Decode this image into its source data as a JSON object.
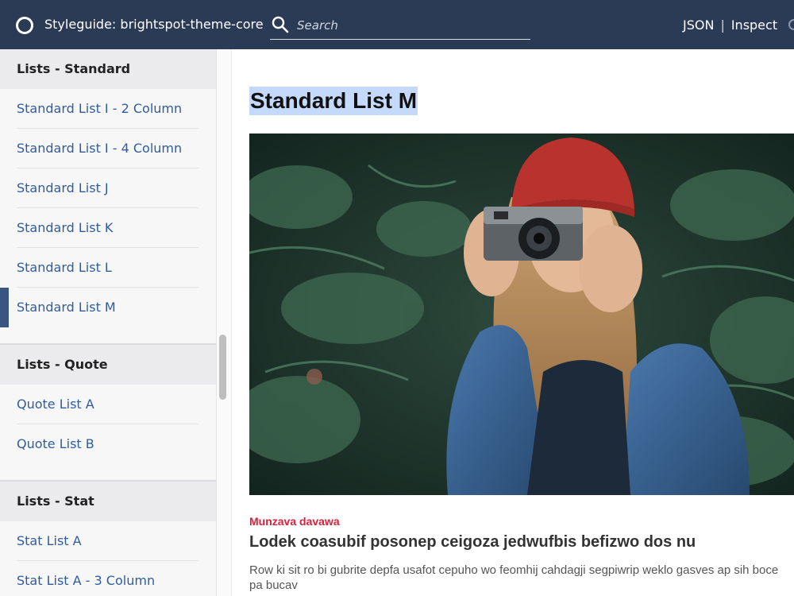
{
  "header": {
    "title": "Styleguide: brightspot-theme-core",
    "search_placeholder": "Search",
    "links": [
      "JSON",
      "Inspect"
    ],
    "separator": "|",
    "colors": {
      "background": "#2b3a55",
      "text": "#ffffff"
    }
  },
  "sidebar": {
    "groups": [
      {
        "title": "Lists - Standard",
        "items": [
          "Standard List I - 2 Column",
          "Standard List I - 4 Column",
          "Standard List J",
          "Standard List K",
          "Standard List L",
          "Standard List M"
        ],
        "active_item": "Standard List M"
      },
      {
        "title": "Lists - Quote",
        "items": [
          "Quote List A",
          "Quote List B"
        ]
      },
      {
        "title": "Lists - Stat",
        "items": [
          "Stat List A",
          "Stat List A - 3 Column"
        ]
      }
    ],
    "colors": {
      "link": "#2f5d9c",
      "active_marker": "#3a5680"
    }
  },
  "main": {
    "page_title": "Standard List M",
    "hero_image": {
      "alt": "Woman in red knit hat holding a camera in front of evergreen trees"
    },
    "promo": {
      "kicker": "Munzava davawa",
      "headline": "Lodek coasubif posonep ceigoza jedwufbis befizwo dos nu",
      "description": "Row ki sit ro bi gubrite depfa usafot cepuho wo feomhij cahdagji segpiwrip weklo gasves ap sih boce pa bucav"
    },
    "colors": {
      "kicker": "#d81f3c",
      "title_highlight": "#c5dafb"
    }
  }
}
